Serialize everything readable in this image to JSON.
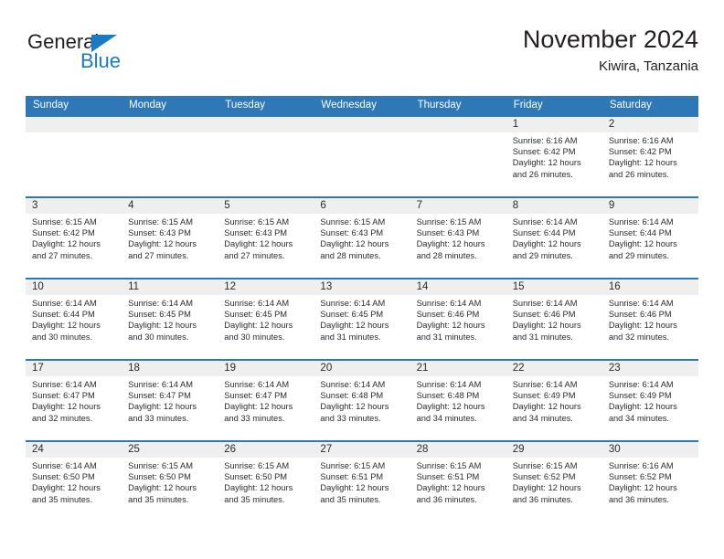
{
  "brand": {
    "name_part1": "General",
    "name_part2": "Blue",
    "triangle_color": "#1a7bc4"
  },
  "header": {
    "title": "November 2024",
    "subtitle": "Kiwira, Tanzania"
  },
  "theme": {
    "header_blue": "#2e78b8",
    "date_band_gray": "#efefef",
    "text_dark": "#231f20"
  },
  "weekdays": [
    "Sunday",
    "Monday",
    "Tuesday",
    "Wednesday",
    "Thursday",
    "Friday",
    "Saturday"
  ],
  "weeks": [
    [
      {
        "day": "",
        "lines": []
      },
      {
        "day": "",
        "lines": []
      },
      {
        "day": "",
        "lines": []
      },
      {
        "day": "",
        "lines": []
      },
      {
        "day": "",
        "lines": []
      },
      {
        "day": "1",
        "lines": [
          "Sunrise: 6:16 AM",
          "Sunset: 6:42 PM",
          "Daylight: 12 hours and 26 minutes."
        ]
      },
      {
        "day": "2",
        "lines": [
          "Sunrise: 6:16 AM",
          "Sunset: 6:42 PM",
          "Daylight: 12 hours and 26 minutes."
        ]
      }
    ],
    [
      {
        "day": "3",
        "lines": [
          "Sunrise: 6:15 AM",
          "Sunset: 6:42 PM",
          "Daylight: 12 hours and 27 minutes."
        ]
      },
      {
        "day": "4",
        "lines": [
          "Sunrise: 6:15 AM",
          "Sunset: 6:43 PM",
          "Daylight: 12 hours and 27 minutes."
        ]
      },
      {
        "day": "5",
        "lines": [
          "Sunrise: 6:15 AM",
          "Sunset: 6:43 PM",
          "Daylight: 12 hours and 27 minutes."
        ]
      },
      {
        "day": "6",
        "lines": [
          "Sunrise: 6:15 AM",
          "Sunset: 6:43 PM",
          "Daylight: 12 hours and 28 minutes."
        ]
      },
      {
        "day": "7",
        "lines": [
          "Sunrise: 6:15 AM",
          "Sunset: 6:43 PM",
          "Daylight: 12 hours and 28 minutes."
        ]
      },
      {
        "day": "8",
        "lines": [
          "Sunrise: 6:14 AM",
          "Sunset: 6:44 PM",
          "Daylight: 12 hours and 29 minutes."
        ]
      },
      {
        "day": "9",
        "lines": [
          "Sunrise: 6:14 AM",
          "Sunset: 6:44 PM",
          "Daylight: 12 hours and 29 minutes."
        ]
      }
    ],
    [
      {
        "day": "10",
        "lines": [
          "Sunrise: 6:14 AM",
          "Sunset: 6:44 PM",
          "Daylight: 12 hours and 30 minutes."
        ]
      },
      {
        "day": "11",
        "lines": [
          "Sunrise: 6:14 AM",
          "Sunset: 6:45 PM",
          "Daylight: 12 hours and 30 minutes."
        ]
      },
      {
        "day": "12",
        "lines": [
          "Sunrise: 6:14 AM",
          "Sunset: 6:45 PM",
          "Daylight: 12 hours and 30 minutes."
        ]
      },
      {
        "day": "13",
        "lines": [
          "Sunrise: 6:14 AM",
          "Sunset: 6:45 PM",
          "Daylight: 12 hours and 31 minutes."
        ]
      },
      {
        "day": "14",
        "lines": [
          "Sunrise: 6:14 AM",
          "Sunset: 6:46 PM",
          "Daylight: 12 hours and 31 minutes."
        ]
      },
      {
        "day": "15",
        "lines": [
          "Sunrise: 6:14 AM",
          "Sunset: 6:46 PM",
          "Daylight: 12 hours and 31 minutes."
        ]
      },
      {
        "day": "16",
        "lines": [
          "Sunrise: 6:14 AM",
          "Sunset: 6:46 PM",
          "Daylight: 12 hours and 32 minutes."
        ]
      }
    ],
    [
      {
        "day": "17",
        "lines": [
          "Sunrise: 6:14 AM",
          "Sunset: 6:47 PM",
          "Daylight: 12 hours and 32 minutes."
        ]
      },
      {
        "day": "18",
        "lines": [
          "Sunrise: 6:14 AM",
          "Sunset: 6:47 PM",
          "Daylight: 12 hours and 33 minutes."
        ]
      },
      {
        "day": "19",
        "lines": [
          "Sunrise: 6:14 AM",
          "Sunset: 6:47 PM",
          "Daylight: 12 hours and 33 minutes."
        ]
      },
      {
        "day": "20",
        "lines": [
          "Sunrise: 6:14 AM",
          "Sunset: 6:48 PM",
          "Daylight: 12 hours and 33 minutes."
        ]
      },
      {
        "day": "21",
        "lines": [
          "Sunrise: 6:14 AM",
          "Sunset: 6:48 PM",
          "Daylight: 12 hours and 34 minutes."
        ]
      },
      {
        "day": "22",
        "lines": [
          "Sunrise: 6:14 AM",
          "Sunset: 6:49 PM",
          "Daylight: 12 hours and 34 minutes."
        ]
      },
      {
        "day": "23",
        "lines": [
          "Sunrise: 6:14 AM",
          "Sunset: 6:49 PM",
          "Daylight: 12 hours and 34 minutes."
        ]
      }
    ],
    [
      {
        "day": "24",
        "lines": [
          "Sunrise: 6:14 AM",
          "Sunset: 6:50 PM",
          "Daylight: 12 hours and 35 minutes."
        ]
      },
      {
        "day": "25",
        "lines": [
          "Sunrise: 6:15 AM",
          "Sunset: 6:50 PM",
          "Daylight: 12 hours and 35 minutes."
        ]
      },
      {
        "day": "26",
        "lines": [
          "Sunrise: 6:15 AM",
          "Sunset: 6:50 PM",
          "Daylight: 12 hours and 35 minutes."
        ]
      },
      {
        "day": "27",
        "lines": [
          "Sunrise: 6:15 AM",
          "Sunset: 6:51 PM",
          "Daylight: 12 hours and 35 minutes."
        ]
      },
      {
        "day": "28",
        "lines": [
          "Sunrise: 6:15 AM",
          "Sunset: 6:51 PM",
          "Daylight: 12 hours and 36 minutes."
        ]
      },
      {
        "day": "29",
        "lines": [
          "Sunrise: 6:15 AM",
          "Sunset: 6:52 PM",
          "Daylight: 12 hours and 36 minutes."
        ]
      },
      {
        "day": "30",
        "lines": [
          "Sunrise: 6:16 AM",
          "Sunset: 6:52 PM",
          "Daylight: 12 hours and 36 minutes."
        ]
      }
    ]
  ]
}
